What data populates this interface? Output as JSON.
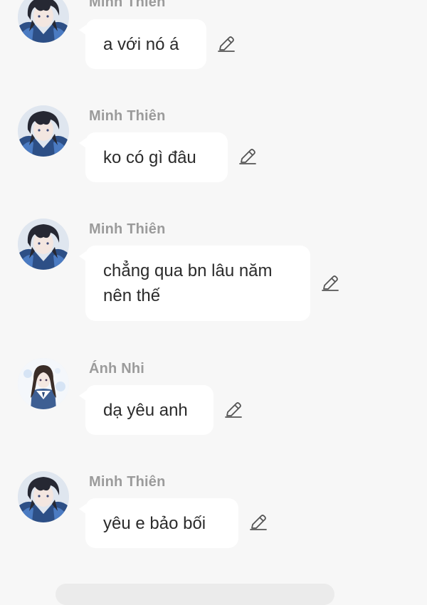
{
  "messages": [
    {
      "sender": "Minh Thiên",
      "text": "a với nó á",
      "avatar": "boy-avatar",
      "icon": "edit-icon"
    },
    {
      "sender": "Minh Thiên",
      "text": "ko có gì đâu",
      "avatar": "boy-avatar",
      "icon": "edit-icon"
    },
    {
      "sender": "Minh Thiên",
      "text": "chẳng qua bn lâu năm nên thế",
      "avatar": "boy-avatar",
      "icon": "edit-icon"
    },
    {
      "sender": "Ánh Nhi",
      "text": "dạ yêu anh",
      "avatar": "girl-avatar",
      "icon": "edit-icon"
    },
    {
      "sender": "Minh Thiên",
      "text": "yêu e bảo bối",
      "avatar": "boy-avatar",
      "icon": "edit-icon"
    }
  ],
  "colors": {
    "background": "#f7f7f7",
    "bubble": "#ffffff",
    "sender_name": "#9b9b9b",
    "message_text": "#2b2b2b",
    "icon": "#555555"
  }
}
